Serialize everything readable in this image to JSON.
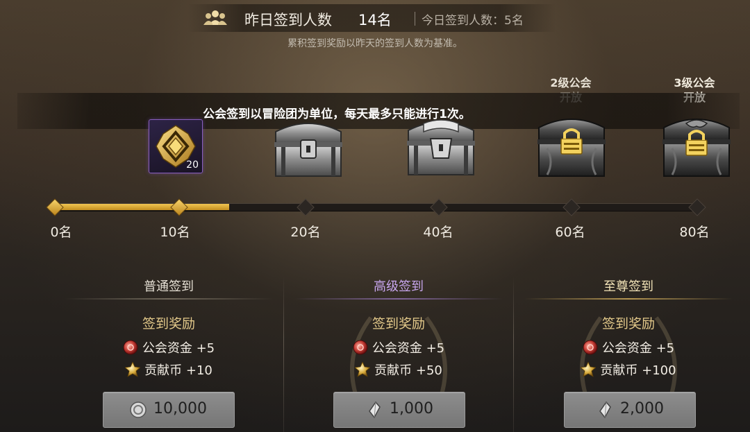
{
  "header": {
    "people_icon": "people-icon",
    "yesterday_label": "昨日签到人数",
    "yesterday_count": "14名",
    "today_text": "今日签到人数：5名",
    "note": "累积签到奖励以昨天的签到人数为基准。"
  },
  "notice": "公会签到以冒险团为单位，每天最多只能进行1次。",
  "guild_levels": [
    {
      "line1": "2级公会",
      "line2": "开放"
    },
    {
      "line1": "3级公会",
      "line2": "开放"
    }
  ],
  "milestone_rewards": [
    {
      "icon": "guild-emblem-badge-icon",
      "count": "20"
    },
    {
      "icon": "silver-chest-icon"
    },
    {
      "icon": "silver-chest-icon"
    },
    {
      "icon": "locked-chest-icon"
    },
    {
      "icon": "locked-chest-icon"
    }
  ],
  "track": {
    "ticks": [
      "0名",
      "10名",
      "20名",
      "40名",
      "60名",
      "80名"
    ],
    "progress_count": 14,
    "colors": {
      "filled": "#e8b83e",
      "empty": "#1f1b18"
    }
  },
  "panels": [
    {
      "title": "普通签到",
      "title_color": "#e6e0d5",
      "reward_header": "签到奖励",
      "rewards": [
        {
          "icon": "guild-fund-icon",
          "text": "公会资金 +5"
        },
        {
          "icon": "contribution-coin-icon",
          "text": "贡献币 +10"
        }
      ],
      "price_icon": "silver-coin-icon",
      "price": "10,000"
    },
    {
      "title": "高级签到",
      "title_color": "#c8a6ee",
      "reward_header": "签到奖励",
      "rewards": [
        {
          "icon": "guild-fund-icon",
          "text": "公会资金 +5"
        },
        {
          "icon": "contribution-coin-icon",
          "text": "贡献币 +50"
        }
      ],
      "price_icon": "crystal-icon",
      "price": "1,000"
    },
    {
      "title": "至尊签到",
      "title_color": "#f3e4b8",
      "reward_header": "签到奖励",
      "rewards": [
        {
          "icon": "guild-fund-icon",
          "text": "公会资金 +5"
        },
        {
          "icon": "contribution-coin-icon",
          "text": "贡献币 +100"
        }
      ],
      "price_icon": "crystal-icon",
      "price": "2,000"
    }
  ]
}
